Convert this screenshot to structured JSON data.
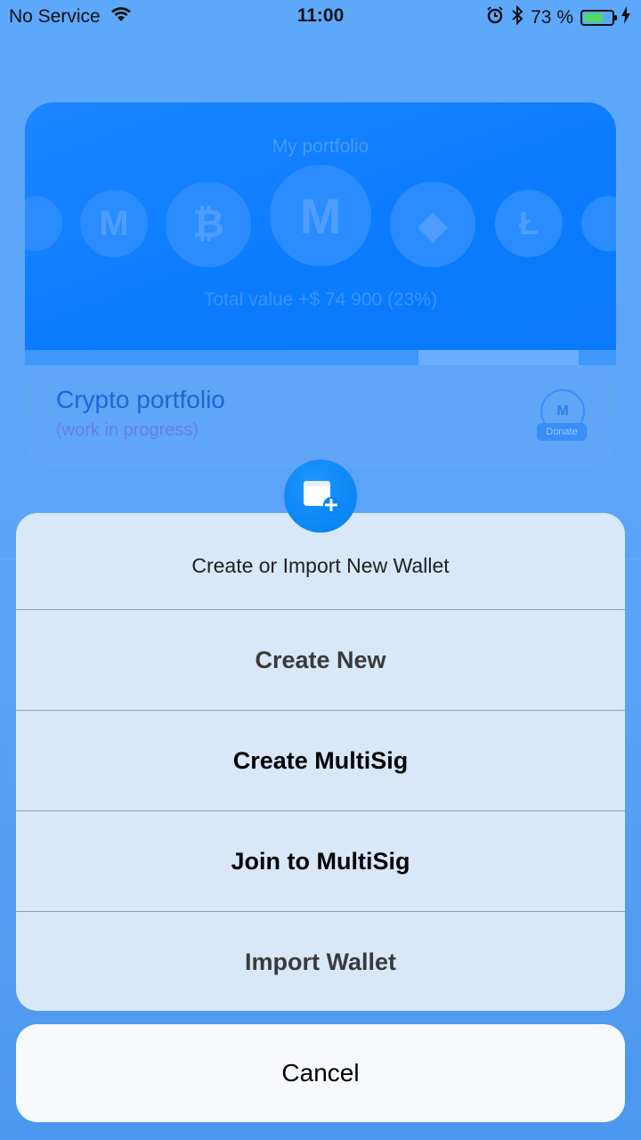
{
  "status_bar": {
    "carrier": "No Service",
    "time": "11:00",
    "battery_percent": "73 %",
    "battery_level": 0.73
  },
  "card": {
    "banner_title": "My portfolio",
    "banner_total": "Total value +$ 74 900 (23%)",
    "title": "Crypto portfolio",
    "subtitle": "(work in progress)",
    "donate_label": "Donate",
    "coins": [
      "steem-icon",
      "monero-icon",
      "bitcoin-icon",
      "monero-icon",
      "ethereum-icon",
      "litecoin-icon",
      "coin-icon"
    ]
  },
  "sheet": {
    "header": "Create or Import New Wallet",
    "options": [
      {
        "label": "Create New"
      },
      {
        "label": "Create MultiSig"
      },
      {
        "label": "Join to MultiSig"
      },
      {
        "label": "Import Wallet"
      }
    ],
    "cancel": "Cancel"
  },
  "colors": {
    "background": "#5aa3f7",
    "accent": "#0a86f5",
    "sheet": "#d8e8f8"
  }
}
